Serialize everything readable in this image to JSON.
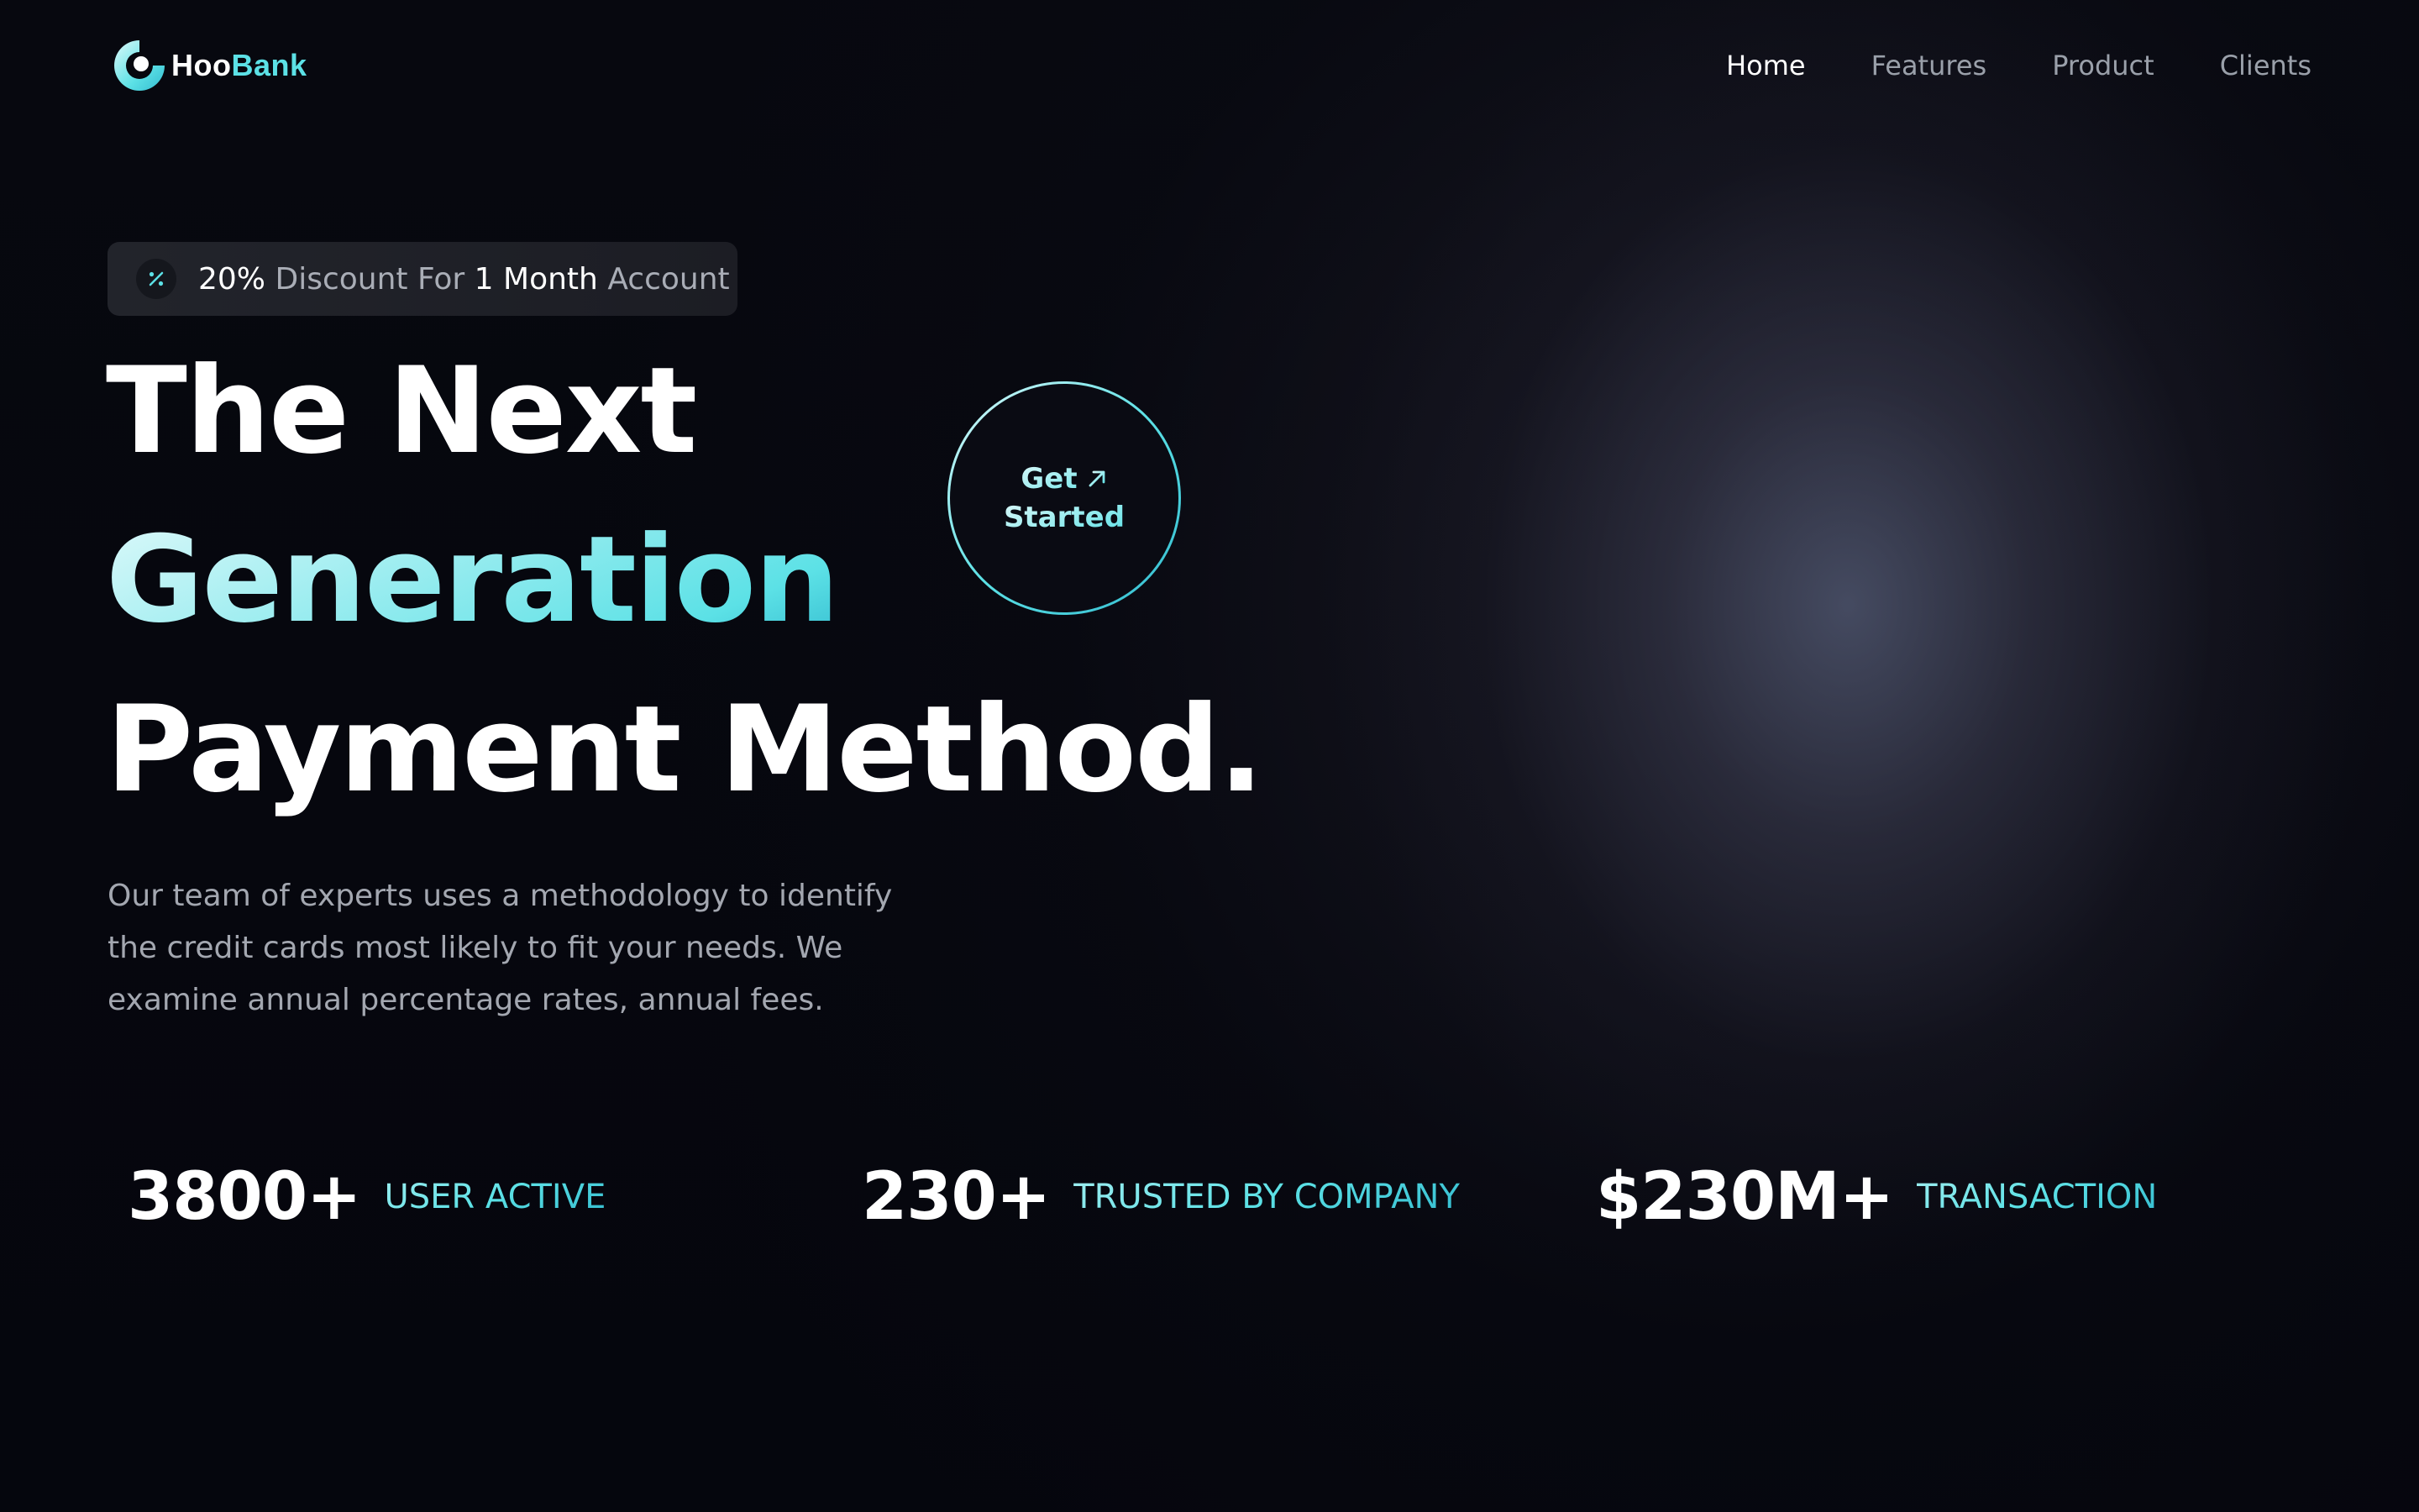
{
  "brand": {
    "name_part1": "Hoo",
    "name_part2": "Bank"
  },
  "nav": {
    "items": [
      {
        "label": "Home",
        "active": true
      },
      {
        "label": "Features",
        "active": false
      },
      {
        "label": "Product",
        "active": false
      },
      {
        "label": "Clients",
        "active": false
      }
    ]
  },
  "discount": {
    "icon": "percent-icon",
    "value": "20%",
    "text1": "Discount For",
    "value2": "1 Month",
    "text2": "Account"
  },
  "hero": {
    "line1": "The Next",
    "line2": "Generation",
    "line3": "Payment Method.",
    "description": "Our team of experts uses a methodology to identify the credit cards most likely to fit your needs. We examine annual percentage rates, annual fees."
  },
  "cta": {
    "line1": "Get",
    "line2": "Started",
    "icon": "arrow-up-right-icon"
  },
  "stats": [
    {
      "value": "3800+",
      "label": "USER ACTIVE"
    },
    {
      "value": "230+",
      "label": "TRUSTED BY COMPANY"
    },
    {
      "value": "$230M+",
      "label": "TRANSACTION"
    }
  ],
  "colors": {
    "accent": "#5ce1e6",
    "accent_dark": "#33bbcf",
    "background": "#05060d",
    "text_dim": "#a3a7b0"
  }
}
